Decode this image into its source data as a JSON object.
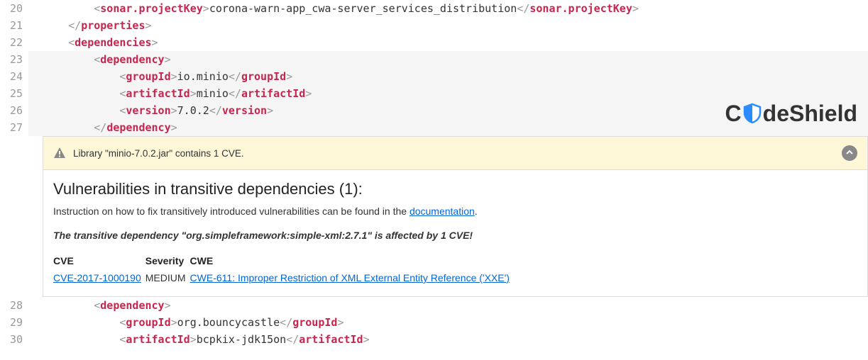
{
  "gutter": {
    "lines_top": [
      "20",
      "21",
      "22",
      "23",
      "24",
      "25",
      "26",
      "27"
    ],
    "lines_bottom": [
      "28",
      "29",
      "30"
    ]
  },
  "code": {
    "line20": {
      "indent": "        ",
      "tag1": "sonar.projectKey",
      "text": "corona-warn-app_cwa-server_services_distribution",
      "tag2": "sonar.projectKey"
    },
    "line21": {
      "indent": "    ",
      "tag": "properties"
    },
    "line22": {
      "indent": "    ",
      "tag": "dependencies"
    },
    "line23": {
      "indent": "        ",
      "tag": "dependency"
    },
    "line24": {
      "indent": "            ",
      "tag1": "groupId",
      "text": "io.minio",
      "tag2": "groupId"
    },
    "line25": {
      "indent": "            ",
      "tag1": "artifactId",
      "text": "minio",
      "tag2": "artifactId"
    },
    "line26": {
      "indent": "            ",
      "tag1": "version",
      "text": "7.0.2",
      "tag2": "version"
    },
    "line27": {
      "indent": "        ",
      "tag": "dependency"
    },
    "line28": {
      "indent": "        ",
      "tag": "dependency"
    },
    "line29": {
      "indent": "            ",
      "tag1": "groupId",
      "text": "org.bouncycastle",
      "tag2": "groupId"
    },
    "line30": {
      "indent": "            ",
      "tag1": "artifactId",
      "text": "bcpkix-jdk15on",
      "tag2": "artifactId"
    }
  },
  "logo": {
    "part1": "C",
    "part2": "deShield"
  },
  "warning": {
    "header_text": "Library \"minio-7.0.2.jar\" contains 1 CVE.",
    "title": "Vulnerabilities in transitive dependencies (1):",
    "instruction_prefix": "Instruction on how to fix transitively introduced vulnerabilities can be found in the ",
    "instruction_link": "documentation",
    "instruction_suffix": ".",
    "affected": "The transitive dependency \"org.simpleframework:simple-xml:2.7.1\" is affected by 1 CVE!",
    "table": {
      "headers": {
        "cve": "CVE",
        "severity": "Severity",
        "cwe": "CWE"
      },
      "row": {
        "cve": "CVE-2017-1000190",
        "severity": "MEDIUM",
        "cwe": "CWE-611: Improper Restriction of XML External Entity Reference ('XXE')"
      }
    }
  }
}
